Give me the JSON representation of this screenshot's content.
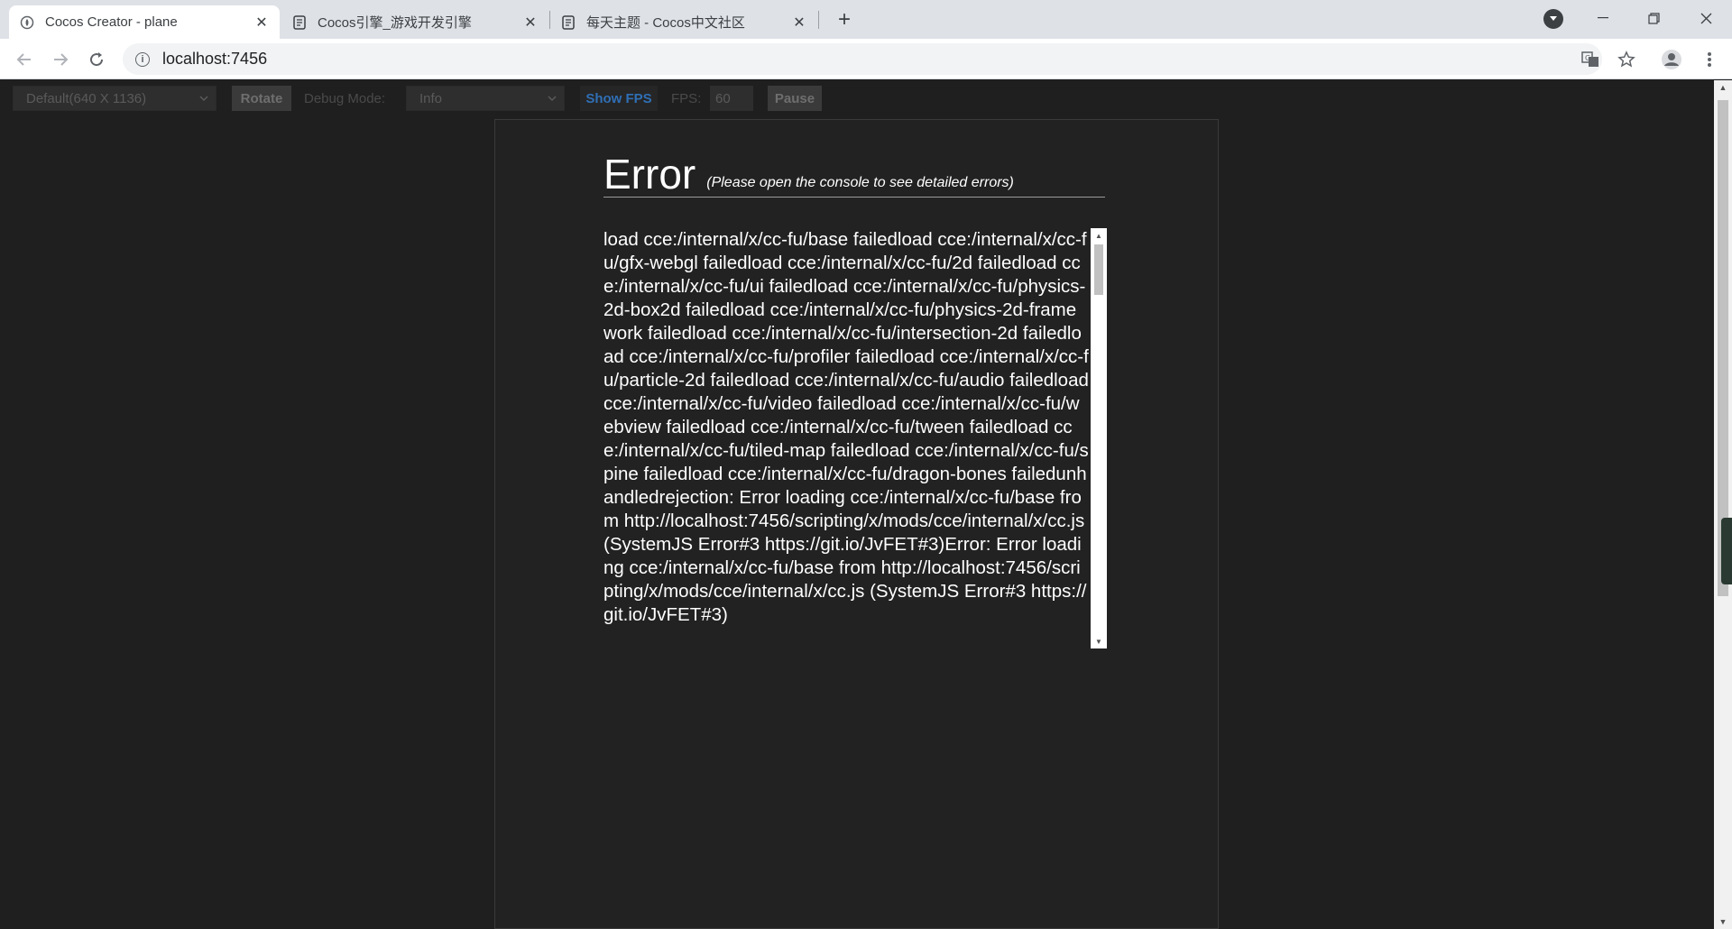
{
  "browser": {
    "tabs": [
      {
        "title": "Cocos Creator - plane",
        "favicon": "cocos-creator-icon",
        "active": true
      },
      {
        "title": "Cocos引擎_游戏开发引擎",
        "favicon": "cocos-doc-icon",
        "active": false
      },
      {
        "title": "每天主题 - Cocos中文社区",
        "favicon": "cocos-doc-icon",
        "active": false
      }
    ],
    "new_tab": "+",
    "address": "localhost:7456"
  },
  "preview_toolbar": {
    "device_select": "Default(640 X 1136)",
    "rotate_label": "Rotate",
    "debug_mode_label": "Debug Mode:",
    "debug_mode_value": "Info",
    "show_fps_label": "Show FPS",
    "fps_label": "FPS:",
    "fps_value": "60",
    "pause_label": "Pause"
  },
  "error": {
    "title": "Error",
    "hint": "(Please open the console to see detailed errors)",
    "message": "load cce:/internal/x/cc-fu/base failedload cce:/internal/x/cc-fu/gfx-webgl failedload cce:/internal/x/cc-fu/2d failedload cce:/internal/x/cc-fu/ui failedload cce:/internal/x/cc-fu/physics-2d-box2d failedload cce:/internal/x/cc-fu/physics-2d-framework failedload cce:/internal/x/cc-fu/intersection-2d failedload cce:/internal/x/cc-fu/profiler failedload cce:/internal/x/cc-fu/particle-2d failedload cce:/internal/x/cc-fu/audio failedload cce:/internal/x/cc-fu/video failedload cce:/internal/x/cc-fu/webview failedload cce:/internal/x/cc-fu/tween failedload cce:/internal/x/cc-fu/tiled-map failedload cce:/internal/x/cc-fu/spine failedload cce:/internal/x/cc-fu/dragon-bones failedunhandledrejection: Error loading cce:/internal/x/cc-fu/base from http://localhost:7456/scripting/x/mods/cce/internal/x/cc.js (SystemJS Error#3 https://git.io/JvFET#3)Error: Error loading cce:/internal/x/cc-fu/base from http://localhost:7456/scripting/x/mods/cce/internal/x/cc.js (SystemJS Error#3 https://git.io/JvFET#3)"
  },
  "colors": {
    "page_bg": "#1f1f1f",
    "tab_strip_bg": "#dee1e6",
    "show_fps_accent": "#2f6fb5"
  }
}
